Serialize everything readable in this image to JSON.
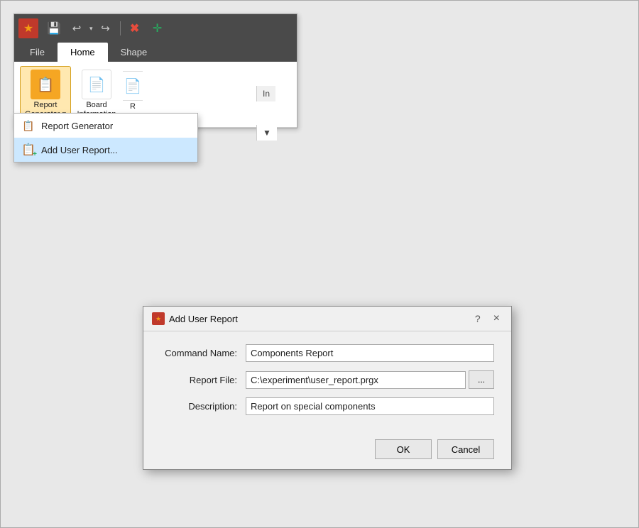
{
  "toolbar": {
    "save_tooltip": "Save",
    "undo_tooltip": "Undo",
    "redo_tooltip": "Redo",
    "delete_tooltip": "Delete",
    "move_tooltip": "Move"
  },
  "ribbon": {
    "tabs": [
      {
        "label": "File",
        "active": false
      },
      {
        "label": "Home",
        "active": true
      },
      {
        "label": "Shape",
        "active": false
      }
    ],
    "buttons": [
      {
        "label": "Report\nGenerator ▾",
        "label1": "Report",
        "label2": "Generator ▾",
        "type": "report-gen"
      },
      {
        "label": "Board\nInformation",
        "label1": "Board",
        "label2": "Information",
        "type": "board-info"
      },
      {
        "label": "R",
        "label1": "R",
        "label2": "",
        "type": "other"
      }
    ]
  },
  "dropdown": {
    "items": [
      {
        "label": "Report Generator",
        "selected": false
      },
      {
        "label": "Add User Report...",
        "selected": true
      }
    ]
  },
  "dialog": {
    "title": "Add User Report",
    "help_btn": "?",
    "close_btn": "×",
    "fields": {
      "command_name_label": "Command Name:",
      "command_name_value": "Components Report",
      "report_file_label": "Report File:",
      "report_file_value": "C:\\experiment\\user_report.prgx",
      "description_label": "Description:",
      "description_value": "Report on special components",
      "browse_label": "..."
    },
    "buttons": {
      "ok": "OK",
      "cancel": "Cancel"
    }
  }
}
